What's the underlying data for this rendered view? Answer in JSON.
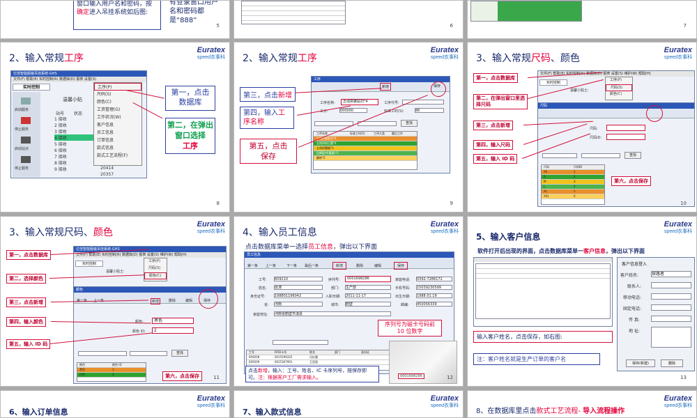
{
  "logo": {
    "brand": "Euratex",
    "sub": "speed衣事科"
  },
  "row0": {
    "s1": {
      "left_text": "窗口输入用户名和密码，按",
      "left_hl": "确定",
      "left_text2": "进入吊挂系统如后图:",
      "right_text": "有登录窗口用户名和密码都是“888”",
      "page": "5"
    },
    "s2": {
      "page": "6"
    },
    "s3": {
      "page": "7"
    }
  },
  "s8": {
    "title_a": "2、输入常规",
    "title_b": "工序",
    "page": "8",
    "win_title": "亿佳智能服装吊挂系统-GHS",
    "menu": "文件(F)  帮助(E)  实时控制(R)  数据库(D)  报表  设置(S)",
    "tab": "实时控制",
    "side": [
      "启动服务",
      "停止服务",
      "启动站点",
      "停止服务"
    ],
    "cols": [
      "站号",
      "状态"
    ],
    "rows": [
      "1 接收",
      "2 接收",
      "3 接收",
      "4 接收",
      "5 接收",
      "6 接收",
      "7 接收",
      "8 接收",
      "9 接收"
    ],
    "nums": [
      "20414",
      "20357"
    ],
    "dropdown": [
      "工序(P)",
      "尺码(S)",
      "颜色(C)",
      "工资管理(G)",
      "工作状况(W)",
      "客户信息",
      "员工信息",
      "订单信息",
      "款式信息",
      "款式工艺流程(F)"
    ],
    "hint": "温馨小贴",
    "call1": "第一，点击数据库",
    "call2": "第二，在弹出窗口选择",
    "call2b": "工序"
  },
  "s9": {
    "title_a": "2、输入常规",
    "title_b": "工序",
    "page": "9",
    "win_title": "工序",
    "labels": [
      "工序名称:",
      "工价:",
      "标准工时(S):",
      "工序代号:"
    ],
    "values": [
      "五线拼腰贴扫*4",
      "000000",
      "86"
    ],
    "buttons": [
      "新增",
      "保存"
    ],
    "search": "查找",
    "cols": [
      "工序名称",
      "标准工时(S)",
      "工序大类",
      "最后工作"
    ],
    "rows": [
      "五线拼腰贴扫*4",
      "五线拼前后腰*4",
      "五线拼腰缝*3",
      "后裤配对(重要)*2",
      "翻转*2"
    ],
    "call3a": "第三，点击",
    "call3b": "新增",
    "call4a": "第四，输入",
    "call4b": "工序",
    "call4c": "名称",
    "call5a": "第五，点击",
    "call5b": "保存"
  },
  "s10": {
    "title_a": "3、输入常规",
    "title_b": "尺码",
    "title_c": "、颜色",
    "page": "10",
    "menu": "文件(F)  帮助(E)  实时控制(R)  数据库(D)  报表  设置(S)  维护(W)  帮助(H)",
    "tab": "实时控制",
    "hint": "温馨小贴士:",
    "dropdown": [
      "工序(P)",
      "尺码(S)",
      "颜色(C)"
    ],
    "win_title": "尺码",
    "labels": [
      "尺码:",
      "尺码ID:"
    ],
    "search": "查找",
    "cols": [
      "尺码",
      "尺码ID"
    ],
    "rows": [
      "XS",
      "S",
      "M",
      "L",
      "XL",
      "XXL"
    ],
    "ids": [
      "1",
      "2",
      "3",
      "4",
      "5",
      "6"
    ],
    "calls": [
      "第一，点击数据库",
      "第二，在弹出窗口里选择尺码",
      "第三，点击新增",
      "第四，输入尺码",
      "第五，输入 ID 码",
      "第六，点击保存"
    ]
  },
  "s11": {
    "title_a": "3、输入常规尺码、",
    "title_b": "颜色",
    "page": "11",
    "win_title": "亿佳智能服装吊挂系统-GHS",
    "menu": "文件(F)  帮助(E)  实时控制(R)  数据库(D)  报表  设置(S)  维护(W)  帮助(H)",
    "tab": "实时控制",
    "hint": "温馨小贴士:",
    "dropdown": [
      "工序(P)",
      "尺码(S)",
      "颜色(C)"
    ],
    "sub_title": "颜色",
    "toolbar": [
      "第一条",
      "上一条",
      "新增",
      "删除",
      "编辑",
      "保存"
    ],
    "labels": [
      "颜色:",
      "颜色 ID:"
    ],
    "values": [
      "黑色",
      "2"
    ],
    "search": "查找",
    "cols": [
      "颜色",
      "颜色 ID"
    ],
    "rows": [
      "黑色",
      "白色"
    ],
    "ids": [
      "1",
      "2"
    ],
    "calls": [
      "第一，点击数据库",
      "第二，选择颜色",
      "第三，点击新增",
      "第四，输入颜色",
      "第五，输入 ID 码",
      "第六，点击保存"
    ]
  },
  "s12": {
    "title": "4、输入员工信息",
    "intro_a": "点击数据库菜单一选择",
    "intro_b": "员工信息",
    "intro_c": "，弹出以下界面",
    "win_title": "员工信息",
    "toolbar": [
      "第一条",
      "上一条",
      "下一条",
      "最后一条",
      "新增",
      "删除",
      "编辑",
      "保存"
    ],
    "fields": [
      {
        "label": "工号:",
        "value": "609210"
      },
      {
        "label": "姓名:",
        "value": "张涛"
      },
      {
        "label": "身份证号:",
        "value": "198801196042"
      },
      {
        "label": "省:",
        "value": "河南"
      },
      {
        "label": "序列号:",
        "value": "0001698286"
      },
      {
        "label": "部门:",
        "value": "生产部"
      },
      {
        "label": "入职日期:",
        "value": "2011-11-17"
      },
      {
        "label": "城市:",
        "value": "鹤壁"
      },
      {
        "label": "家庭电话:",
        "value": "0392-7286172"
      },
      {
        "label": "手机号码:",
        "value": "15039230599"
      },
      {
        "label": "出生日期:",
        "value": "1988.01.19"
      },
      {
        "label": "邮编:",
        "value": "450056339"
      }
    ],
    "address_label": "家庭地址:",
    "address": "河南省鹤壁市淇县",
    "cols": [
      "工号",
      "RFID卡号",
      "姓名",
      "部门",
      "身份证"
    ],
    "rows": [
      [
        "609208",
        "0015599325",
        "冯红霞"
      ],
      [
        "609209",
        "0015367901",
        "王亚丽"
      ]
    ],
    "card_note": "序列号为磁卡号码前 10 位数字",
    "card_num": "0001698286",
    "bottom_a": "点击",
    "bottom_b": "新增",
    "bottom_c": "，输入：工号、姓名、IC 卡序列号，按保存即可。",
    "bottom_d": "注：根据客户工厂需求输入。",
    "page": "12"
  },
  "s13": {
    "title": "5、输入客户信息",
    "intro_a": "软件打开后出现的界面，点击数据库菜单一",
    "intro_b": "客户信息",
    "intro_c": "，弹出以下界面",
    "panel_title": "客户信息登入",
    "labels": [
      "客户姓名:",
      "联系人:",
      "移动电话:",
      "固定电话:",
      "传 真:",
      "地 址:"
    ],
    "name_value": "探路者",
    "buttons": [
      "保存(新建)",
      "删除"
    ],
    "note1": "输入客户姓名，点击保存，如右图:",
    "note2": "注：客户姓名就是生产订单的客户名",
    "page": "13"
  },
  "row3": {
    "s14": {
      "title": "6、输入订单信息"
    },
    "s15": {
      "title": "7、输入款式信息"
    },
    "s16": {
      "title_a": "8、在数据库里点击",
      "title_b": "款式工艺流程",
      "title_c": "- ",
      "title_d": "导入流程操作"
    }
  }
}
